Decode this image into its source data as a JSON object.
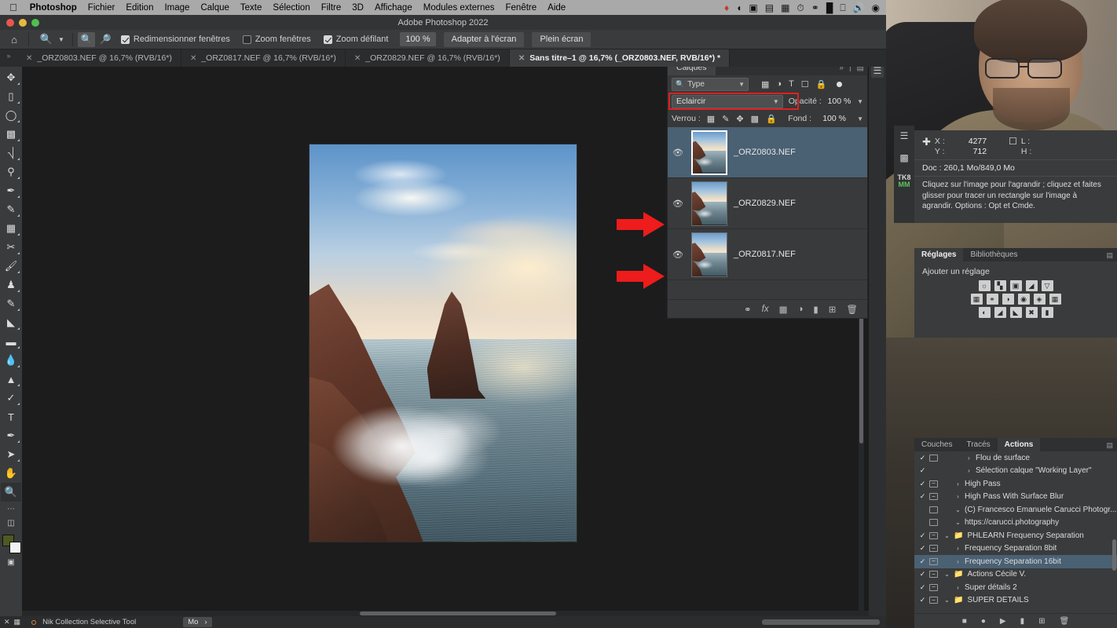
{
  "macmenu": {
    "apple": "apple-logo",
    "items": [
      "Photoshop",
      "Fichier",
      "Edition",
      "Image",
      "Calque",
      "Texte",
      "Sélection",
      "Filtre",
      "3D",
      "Affichage",
      "Modules externes",
      "Fenêtre",
      "Aide"
    ],
    "status_icons": [
      "dropbox-icon",
      "cloud-icon",
      "screen-record-icon",
      "rectangle-icon",
      "battery-icon",
      "clock-icon",
      "binoculars-icon",
      "bars-icon",
      "display-icon",
      "volume-icon",
      "control-center-icon"
    ]
  },
  "titlebar": {
    "title": "Adobe Photoshop 2022"
  },
  "optionsbar": {
    "home_icon": "home-icon",
    "tool_icon": "zoom-tool-icon",
    "tool_chevron": "chevron-down-icon",
    "zoom_in_label": "zoom-in-icon",
    "zoom_out_label": "zoom-out-icon",
    "checkbox_resize_windows": {
      "label": "Redimensionner fenêtres",
      "checked": true
    },
    "checkbox_zoom_windows": {
      "label": "Zoom fenêtres",
      "checked": false
    },
    "checkbox_zoom_scroll": {
      "label": "Zoom défilant",
      "checked": true
    },
    "zoom_value": "100 %",
    "fit_screen": "Adapter à l'écran",
    "fullscreen": "Plein écran"
  },
  "tabs": [
    {
      "label": "_ORZ0803.NEF @ 16,7% (RVB/16*)",
      "active": false
    },
    {
      "label": "_ORZ0817.NEF @ 16,7% (RVB/16*)",
      "active": false
    },
    {
      "label": "_ORZ0829.NEF @ 16,7% (RVB/16*)",
      "active": false
    },
    {
      "label": "Sans titre–1 @ 16,7% (_ORZ0803.NEF, RVB/16*) *",
      "active": true
    }
  ],
  "toolbar": {
    "tools": [
      {
        "name": "move-tool",
        "glyph": "✥"
      },
      {
        "name": "marquee-tool",
        "glyph": "▭"
      },
      {
        "name": "lasso-tool",
        "glyph": "◯"
      },
      {
        "name": "object-selection-tool",
        "glyph": "◩"
      },
      {
        "name": "crop-tool",
        "glyph": "⌗"
      },
      {
        "name": "eyedropper-tool",
        "glyph": "⚲"
      },
      {
        "name": "healing-brush-tool",
        "glyph": "✒"
      },
      {
        "name": "patch-tool",
        "glyph": "✎"
      },
      {
        "name": "frame-tool",
        "glyph": "▤"
      },
      {
        "name": "shuffle-tool",
        "glyph": "✂"
      },
      {
        "name": "brush-tool",
        "glyph": "🖌"
      },
      {
        "name": "clone-stamp-tool",
        "glyph": "♟"
      },
      {
        "name": "history-brush-tool",
        "glyph": "✐"
      },
      {
        "name": "eraser-tool",
        "glyph": "◣"
      },
      {
        "name": "gradient-tool",
        "glyph": "▬"
      },
      {
        "name": "blur-tool",
        "glyph": "💧"
      },
      {
        "name": "dodge-tool",
        "glyph": "▲"
      },
      {
        "name": "pen-tool",
        "glyph": "✑"
      },
      {
        "name": "type-tool",
        "glyph": "T"
      },
      {
        "name": "path-tool",
        "glyph": "✒"
      },
      {
        "name": "path-selection-tool",
        "glyph": "➤"
      },
      {
        "name": "hand-tool",
        "glyph": "✋"
      },
      {
        "name": "zoom-tool",
        "glyph": "🔍",
        "active": true
      }
    ],
    "more_tools": "…",
    "quickmask": "quick-mask-icon",
    "screenmode": "screen-mode-icon"
  },
  "canvas": {
    "zoom_cursor_icon": "zoom-cursor-icon",
    "arrows": [
      {
        "name": "red-arrow-top"
      },
      {
        "name": "red-arrow-bottom"
      }
    ]
  },
  "layers_panel": {
    "tab_label": "Calques",
    "collapse_icon": "double-chevron-icon",
    "menu_icon": "panel-menu-icon",
    "filter": {
      "label": "Type",
      "search_icon": "search-icon",
      "chevron": "chevron-down-icon"
    },
    "filter_icons": [
      "pixel-filter-icon",
      "adjustment-filter-icon",
      "type-filter-icon",
      "shape-filter-icon",
      "smartobject-filter-icon"
    ],
    "filter_toggle": "filter-enable-toggle",
    "blend_mode": "Eclaircir",
    "blend_chevron": "chevron-down-icon",
    "opacity_label": "Opacité :",
    "opacity_value": "100 %",
    "lock_label": "Verrou :",
    "lock_icons": [
      "lock-transparency-icon",
      "lock-image-icon",
      "lock-position-icon",
      "lock-artboard-icon",
      "lock-all-icon"
    ],
    "fill_label": "Fond :",
    "fill_value": "100 %",
    "highlight_color": "#e02020",
    "layers": [
      {
        "name": "_ORZ0803.NEF",
        "visible": true,
        "selected": true,
        "eye_icon": "eye-icon"
      },
      {
        "name": "_ORZ0829.NEF",
        "visible": true,
        "selected": false,
        "eye_icon": "eye-icon"
      },
      {
        "name": "_ORZ0817.NEF",
        "visible": true,
        "selected": false,
        "eye_icon": "eye-icon"
      }
    ],
    "footer_icons": [
      "link-layers-icon",
      "layer-style-fx-icon",
      "layer-mask-icon",
      "adjustment-layer-icon",
      "new-group-icon",
      "new-layer-icon",
      "delete-layer-icon"
    ],
    "footer_labels": [
      "⚭",
      "fx",
      "◼",
      "◐",
      "▬",
      "⊞",
      "🗑"
    ]
  },
  "rail": {
    "icons": [
      "layers-rail-icon"
    ]
  },
  "info_panel": {
    "rail_icons": [
      "properties-icon",
      "histogram-icon"
    ],
    "plugin_badge": {
      "line1": "TK8",
      "line2": "MM"
    },
    "cursor_icon": "crosshair-icon",
    "x_label": "X :",
    "x_value": "4277",
    "y_label": "Y :",
    "y_value": "712",
    "selection_icon": "selection-rect-icon",
    "w_label": "L :",
    "w_value": "",
    "h_label": "H :",
    "h_value": "",
    "doc_line": "Doc : 260,1 Mo/849,0 Mo",
    "hint": "Cliquez sur l'image pour l'agrandir ; cliquez et faites glisser pour tracer un rectangle sur l'image à agrandir. Options : Opt et Cmde."
  },
  "adjustments_panel": {
    "tabs": [
      {
        "label": "Réglages",
        "active": true
      },
      {
        "label": "Bibliothèques",
        "active": false
      }
    ],
    "menu_icon": "panel-menu-icon",
    "add_label": "Ajouter un réglage",
    "icon_rows": [
      [
        "brightness-contrast-icon",
        "levels-icon",
        "curves-icon",
        "exposure-icon",
        "vibrance-icon"
      ],
      [
        "hue-saturation-icon",
        "color-balance-icon",
        "black-white-icon",
        "photo-filter-icon",
        "channel-mixer-icon",
        "color-lookup-icon"
      ],
      [
        "invert-icon",
        "posterize-icon",
        "threshold-icon",
        "gradient-map-icon",
        "selective-color-icon"
      ]
    ]
  },
  "actions_panel": {
    "tabs": [
      {
        "label": "Couches",
        "active": false
      },
      {
        "label": "Tracés",
        "active": false
      },
      {
        "label": "Actions",
        "active": true
      }
    ],
    "menu_icon": "panel-menu-icon",
    "rows": [
      {
        "check": true,
        "box": "empty",
        "tri": "›",
        "folder": false,
        "indent": 2,
        "label": "Flou de surface",
        "selected": false
      },
      {
        "check": true,
        "box": "none",
        "tri": "›",
        "folder": false,
        "indent": 2,
        "label": "Sélection calque \"Working Layer\"",
        "selected": false
      },
      {
        "check": true,
        "box": "minus",
        "tri": "›",
        "folder": false,
        "indent": 1,
        "label": "High Pass",
        "selected": false
      },
      {
        "check": true,
        "box": "minus",
        "tri": "›",
        "folder": false,
        "indent": 1,
        "label": "High Pass With Surface Blur",
        "selected": false
      },
      {
        "check": false,
        "box": "empty",
        "tri": "⌄",
        "folder": false,
        "indent": 1,
        "label": "(C) Francesco Emanuele Carucci Photogr...",
        "selected": false
      },
      {
        "check": false,
        "box": "empty",
        "tri": "⌄",
        "folder": false,
        "indent": 1,
        "label": "https://carucci.photography",
        "selected": false
      },
      {
        "check": true,
        "box": "minus",
        "tri": "⌄",
        "folder": true,
        "indent": 0,
        "label": "PHLEARN Frequency Separation",
        "selected": false
      },
      {
        "check": true,
        "box": "minus",
        "tri": "›",
        "folder": false,
        "indent": 1,
        "label": "Frequency Separation 8bit",
        "selected": false
      },
      {
        "check": true,
        "box": "minus",
        "tri": "›",
        "folder": false,
        "indent": 1,
        "label": "Frequency Separation 16bit",
        "selected": true
      },
      {
        "check": true,
        "box": "minus",
        "tri": "⌄",
        "folder": true,
        "indent": 0,
        "label": "Actions Cécile V.",
        "selected": false
      },
      {
        "check": true,
        "box": "minus",
        "tri": "›",
        "folder": false,
        "indent": 1,
        "label": "Super détails 2",
        "selected": false
      },
      {
        "check": true,
        "box": "minus",
        "tri": "⌄",
        "folder": true,
        "indent": 0,
        "label": "SUPER DÉTAILS",
        "selected": false
      }
    ],
    "footer_icons": [
      "stop-icon",
      "record-icon",
      "play-icon",
      "new-set-icon",
      "new-action-icon",
      "delete-action-icon"
    ],
    "footer_glyphs": [
      "■",
      "●",
      "▶",
      "▬",
      "⊞",
      "🗑"
    ]
  },
  "statusbar": {
    "left_icons": [
      "close-icon",
      "save-icon"
    ],
    "plugin_dot": "nik-dot-icon",
    "plugin_label": "Nik Collection Selective Tool",
    "unit_label": "Mo",
    "unit_chevron": "›"
  }
}
